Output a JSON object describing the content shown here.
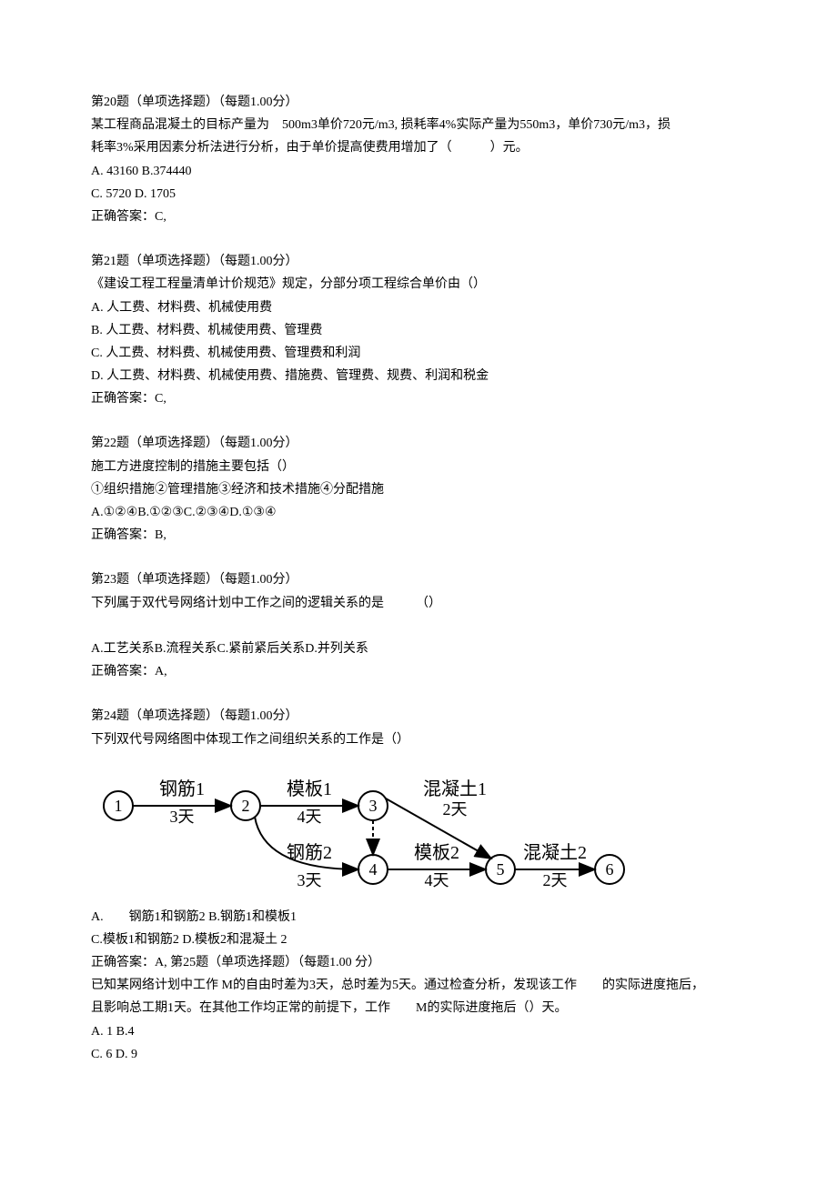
{
  "q20": {
    "header": "第20题（单项选择题）（每题1.00分）",
    "stem1": "某工程商品混凝土的目标产量为　500m3单价720元/m3, 损耗率4%实际产量为550m3，单价730元/m3，损",
    "stem2": "耗率3%采用因素分析法进行分析，由于单价提高使费用增加了（　　　）元。",
    "optA": "A.  43160 B.374440",
    "optC": "C.  5720 D. 1705",
    "ans": "正确答案：C,"
  },
  "q21": {
    "header": "第21题（单项选择题）（每题1.00分）",
    "stem": "《建设工程工程量清单计价规范》规定，分部分项工程综合单价由（）",
    "optA": "A.  人工费、材料费、机械使用费",
    "optB": "B.  人工费、材料费、机械使用费、管理费",
    "optC": "C.  人工费、材料费、机械使用费、管理费和利润",
    "optD": "D.  人工费、材料费、机械使用费、措施费、管理费、规费、利润和税金",
    "ans": "正确答案：C,"
  },
  "q22": {
    "header": "第22题（单项选择题）（每题1.00分）",
    "stem1": "施工方进度控制的措施主要包括（）",
    "stem2": "①组织措施②管理措施③经济和技术措施④分配措施",
    "opts": "A.①②④B.①②③C.②③④D.①③④",
    "ans": "正确答案：B,"
  },
  "q23": {
    "header": "第23题（单项选择题）（每题1.00分）",
    "stem": "下列属于双代号网络计划中工作之间的逻辑关系的是　　　（）",
    "opts": "A.工艺关系B.流程关系C.紧前紧后关系D.并列关系",
    "ans": "正确答案：A,"
  },
  "q24": {
    "header": "第24题（单项选择题）（每题1.00分）",
    "stem": "下列双代号网络图中体现工作之间组织关系的工作是（）",
    "optA": "A.　　钢筋1和钢筋2 B.钢筋1和模板1",
    "optC": "C.模板1和钢筋2 D.模板2和混凝土  2",
    "ans": "正确答案：A, 第25题（单项选择题）（每题1.00 分）"
  },
  "q25": {
    "stem1": "已知某网络计划中工作 M的自由时差为3天，总时差为5天。通过检查分析，发现该工作　　的实际进度拖后，",
    "stem2": "且影响总工期1天。在其他工作均正常的前提下，工作　　M的实际进度拖后（）天。",
    "optA": "A.  1 B.4",
    "optC": "C.  6 D. 9"
  },
  "diagram": {
    "nodes": [
      "1",
      "2",
      "3",
      "4",
      "5",
      "6"
    ],
    "top_labels": [
      "钢筋1",
      "模板1",
      "混凝土1"
    ],
    "top_days": [
      "3天",
      "4天",
      "2天"
    ],
    "bot_labels": [
      "钢筋2",
      "模板2",
      "混凝土2"
    ],
    "bot_days": [
      "3天",
      "4天",
      "2天"
    ]
  }
}
